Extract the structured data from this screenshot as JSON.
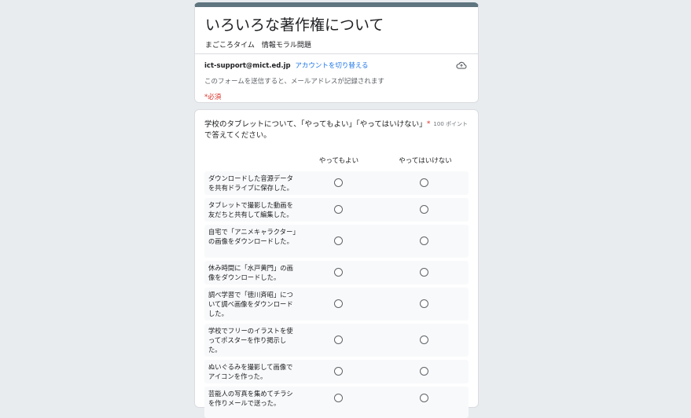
{
  "header": {
    "title": "いろいろな著作権について",
    "description": "まごころタイム　情報モラル問題",
    "account_email": "ict-support@mict.ed.jp",
    "switch_account": "アカウントを切り替える",
    "notice": "このフォームを送信すると、メールアドレスが記録されます",
    "required_note": "*必須"
  },
  "question": {
    "title": "学校のタブレットについて、「やってもよい」「やってはいけない」で答えてください。",
    "required_mark": "*",
    "points": "100 ポイント",
    "columns": [
      "やってもよい",
      "やってはいけない"
    ],
    "rows": [
      "ダウンロードした音源データを共有ドライブに保存した。",
      "タブレットで撮影した動画を友だちと共有して編集した。",
      "自宅で「アニメキャラクター」の画像をダウンロードした。",
      "休み時間に「水戸黄門」の画像をダウンロードした。",
      "調べ学習で「徳川斉昭」について調べ画像をダウンロードした。",
      "学校でフリーのイラストを使ってポスターを作り掲示した。",
      "ぬいぐるみを撮影して画像でアイコンを作った。",
      "芸能人の写真を集めてチラシを作りメールで送った。"
    ]
  }
}
